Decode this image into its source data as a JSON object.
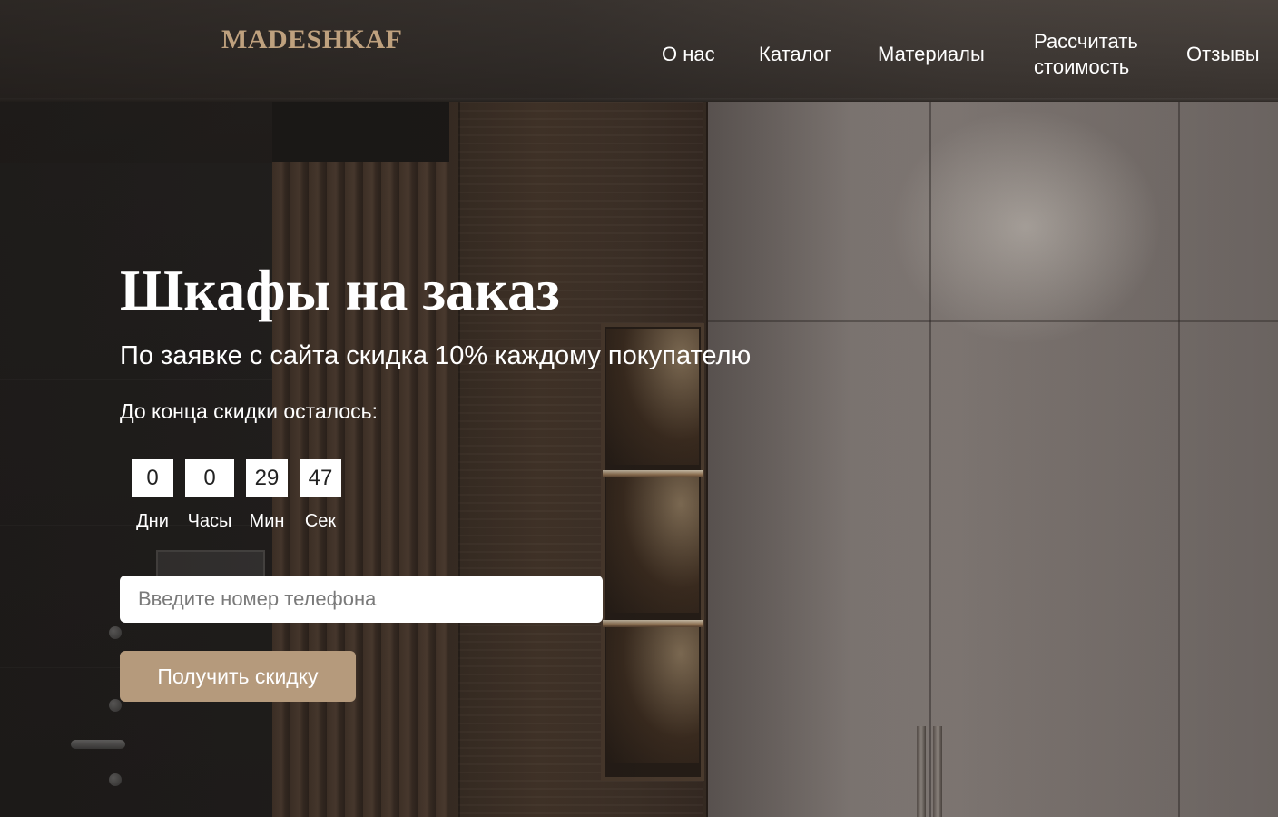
{
  "header": {
    "logo": "MADESHKAF",
    "nav": [
      {
        "label": "О нас"
      },
      {
        "label": "Каталог"
      },
      {
        "label": "Материалы"
      },
      {
        "label": "Рассчитать\nстоимость"
      },
      {
        "label": "Отзывы"
      }
    ]
  },
  "hero": {
    "title": "Шкафы на заказ",
    "subtitle": "По заявке с сайта скидка 10% каждому покупателю",
    "timer_caption": "До конца скидки осталось:",
    "timer": [
      {
        "value": "0",
        "label": "Дни"
      },
      {
        "value": "0",
        "label": "Часы"
      },
      {
        "value": "29",
        "label": "Мин"
      },
      {
        "value": "47",
        "label": "Сек"
      }
    ],
    "phone_placeholder": "Введите номер телефона",
    "phone_value": "",
    "cta_label": "Получить скидку"
  },
  "colors": {
    "logo": "#bfa17e",
    "cta_background": "#b59a7c",
    "text": "#ffffff"
  }
}
